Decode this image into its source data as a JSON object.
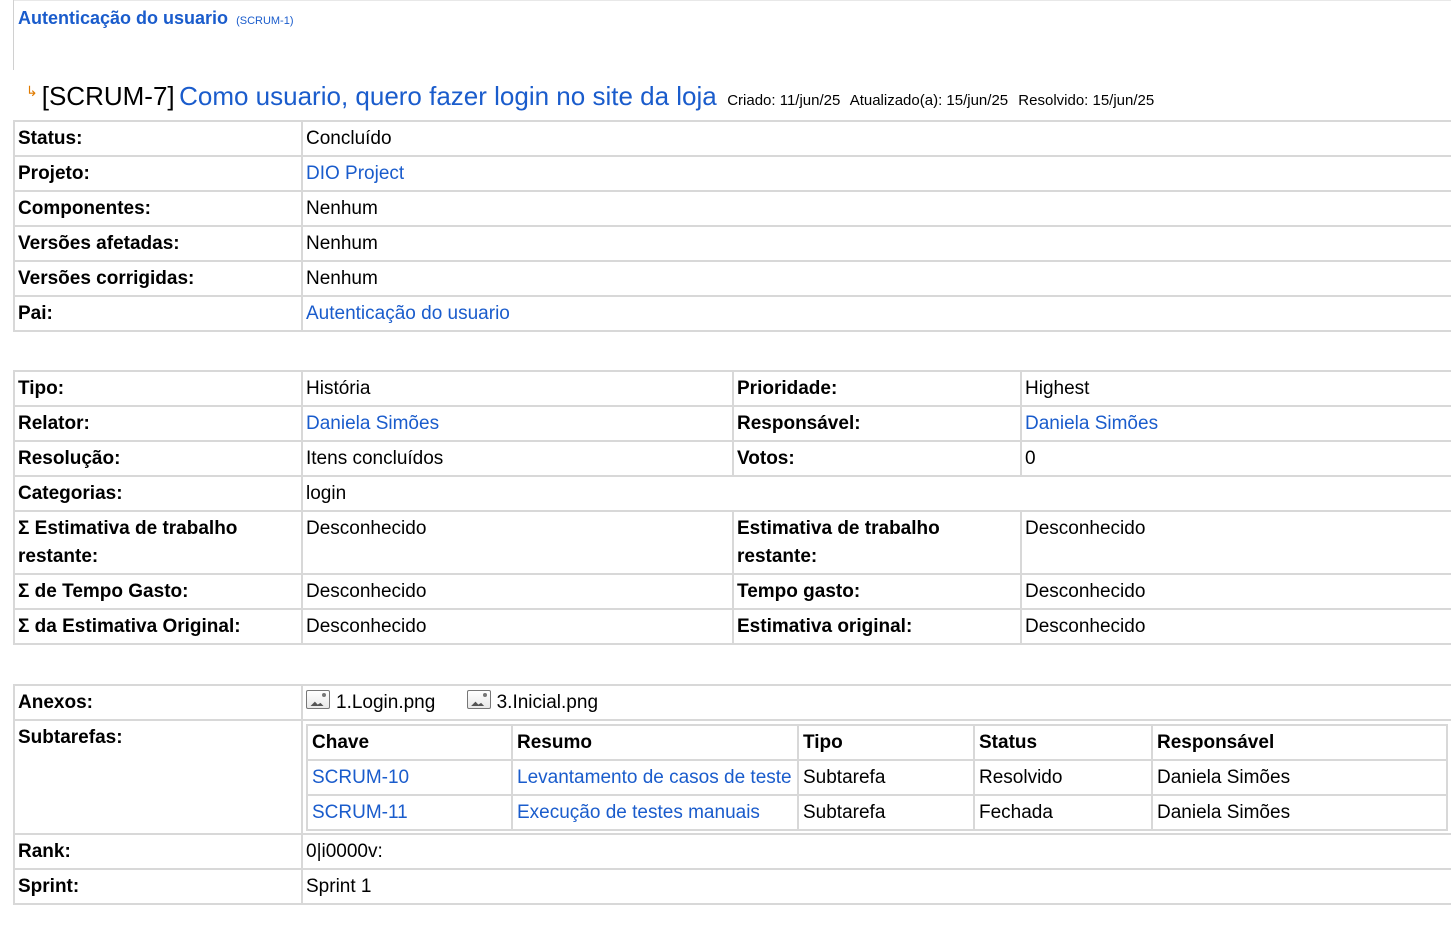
{
  "parent": {
    "title": "Autenticação do usuario",
    "key": "(SCRUM-1)"
  },
  "issue": {
    "key": "[SCRUM-7]",
    "title": "Como usuario, quero fazer login no site da loja",
    "created": "Criado: 11/jun/25",
    "updated": "Atualizado(a): 15/jun/25",
    "resolved": "Resolvido: 15/jun/25"
  },
  "details": [
    {
      "label": "Status:",
      "value": "Concluído",
      "link": false
    },
    {
      "label": "Projeto:",
      "value": "DIO Project",
      "link": true
    },
    {
      "label": "Componentes:",
      "value": "Nenhum",
      "link": false
    },
    {
      "label": "Versões afetadas:",
      "value": "Nenhum",
      "link": false
    },
    {
      "label": "Versões corrigidas:",
      "value": "Nenhum",
      "link": false
    },
    {
      "label": "Pai:",
      "value": "Autenticação do usuario",
      "link": true
    }
  ],
  "fields": {
    "tipo_label": "Tipo:",
    "tipo": "História",
    "prioridade_label": "Prioridade:",
    "prioridade": "Highest",
    "relator_label": "Relator:",
    "relator": "Daniela Simões",
    "responsavel_label": "Responsável:",
    "responsavel": "Daniela Simões",
    "resolucao_label": "Resolução:",
    "resolucao": "Itens concluídos",
    "votos_label": "Votos:",
    "votos": "0",
    "categorias_label": "Categorias:",
    "categorias": "login",
    "sum_restante_label": "Σ Estimativa de trabalho restante:",
    "sum_restante": "Desconhecido",
    "restante_label": "Estimativa de trabalho restante:",
    "restante": "Desconhecido",
    "sum_gasto_label": "Σ de Tempo Gasto:",
    "sum_gasto": "Desconhecido",
    "gasto_label": "Tempo gasto:",
    "gasto": "Desconhecido",
    "sum_original_label": "Σ da Estimativa Original:",
    "sum_original": "Desconhecido",
    "original_label": "Estimativa original:",
    "original": "Desconhecido"
  },
  "anexos": {
    "label": "Anexos:",
    "files": [
      "1.Login.png",
      "3.Inicial.png"
    ]
  },
  "subtarefas": {
    "label": "Subtarefas:",
    "headers": [
      "Chave",
      "Resumo",
      "Tipo",
      "Status",
      "Responsável"
    ],
    "rows": [
      {
        "key": "SCRUM-10",
        "summary": "Levantamento de casos de teste",
        "type": "Subtarefa",
        "status": "Resolvido",
        "assignee": "Daniela Simões"
      },
      {
        "key": "SCRUM-11",
        "summary": "Execução de testes manuais",
        "type": "Subtarefa",
        "status": "Fechada",
        "assignee": "Daniela Simões"
      }
    ]
  },
  "rank": {
    "label": "Rank:",
    "value": "0|i0000v:"
  },
  "sprint": {
    "label": "Sprint:",
    "value": "Sprint 1"
  }
}
